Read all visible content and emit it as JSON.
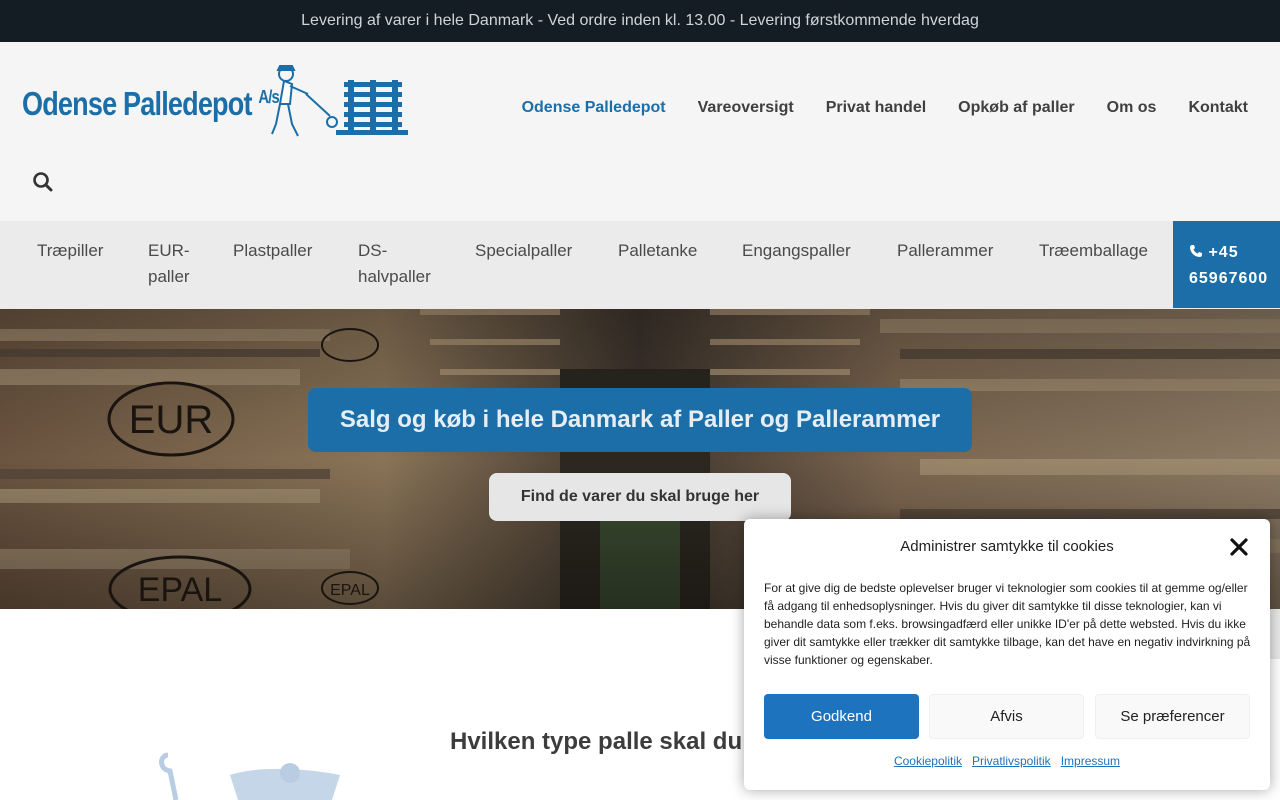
{
  "topbar": {
    "text": "Levering af varer i hele Danmark - Ved ordre inden kl. 13.00 - Levering førstkommende hverdag"
  },
  "header": {
    "logo_text": "Odense Palledepot",
    "logo_suffix": "A/s",
    "nav": [
      {
        "label": "Odense Palledepot",
        "active": true
      },
      {
        "label": "Vareoversigt"
      },
      {
        "label": "Privat handel"
      },
      {
        "label": "Opkøb af paller"
      },
      {
        "label": "Om os"
      },
      {
        "label": "Kontakt"
      }
    ],
    "search_icon": "search-icon"
  },
  "categories": [
    {
      "line1": "Træpiller",
      "line2": ""
    },
    {
      "line1": "EUR-",
      "line2": "paller"
    },
    {
      "line1": "Plastpaller",
      "line2": ""
    },
    {
      "line1": "DS-",
      "line2": "halvpaller"
    },
    {
      "line1": "Specialpaller",
      "line2": ""
    },
    {
      "line1": "Palletanke",
      "line2": ""
    },
    {
      "line1": "Engangspaller",
      "line2": ""
    },
    {
      "line1": "Pallerammer",
      "line2": ""
    },
    {
      "line1": "Træemballage",
      "line2": ""
    }
  ],
  "phone": {
    "line1": "+45",
    "line2": "65967600",
    "icon": "phone-icon"
  },
  "hero": {
    "title": "Salg og køb i hele Danmark af Paller og Pallerammer",
    "button": "Find de varer du skal bruge her",
    "stamp_text_1": "EUR",
    "stamp_text_2": "EPAL",
    "stamp_text_3": "EPAL"
  },
  "content": {
    "section_title": "Hvilken type palle skal du"
  },
  "cookie": {
    "title": "Administrer samtykke til cookies",
    "body": "For at give dig de bedste oplevelser bruger vi teknologier som cookies til at gemme og/eller få adgang til enhedsoplysninger. Hvis du giver dit samtykke til disse teknologier, kan vi behandle data som f.eks. browsingadfærd eller unikke ID'er på dette websted. Hvis du ikke giver dit samtykke eller trækker dit samtykke tilbage, kan det have en negativ indvirkning på visse funktioner og egenskaber.",
    "accept": "Godkend",
    "deny": "Afvis",
    "preferences": "Se præferencer",
    "links": [
      "Cookiepolitik",
      "Privatlivspolitik",
      "Impressum"
    ]
  },
  "colors": {
    "brand_blue": "#1b6ea8",
    "topbar_bg": "#141d24",
    "accept_blue": "#1e73be"
  }
}
